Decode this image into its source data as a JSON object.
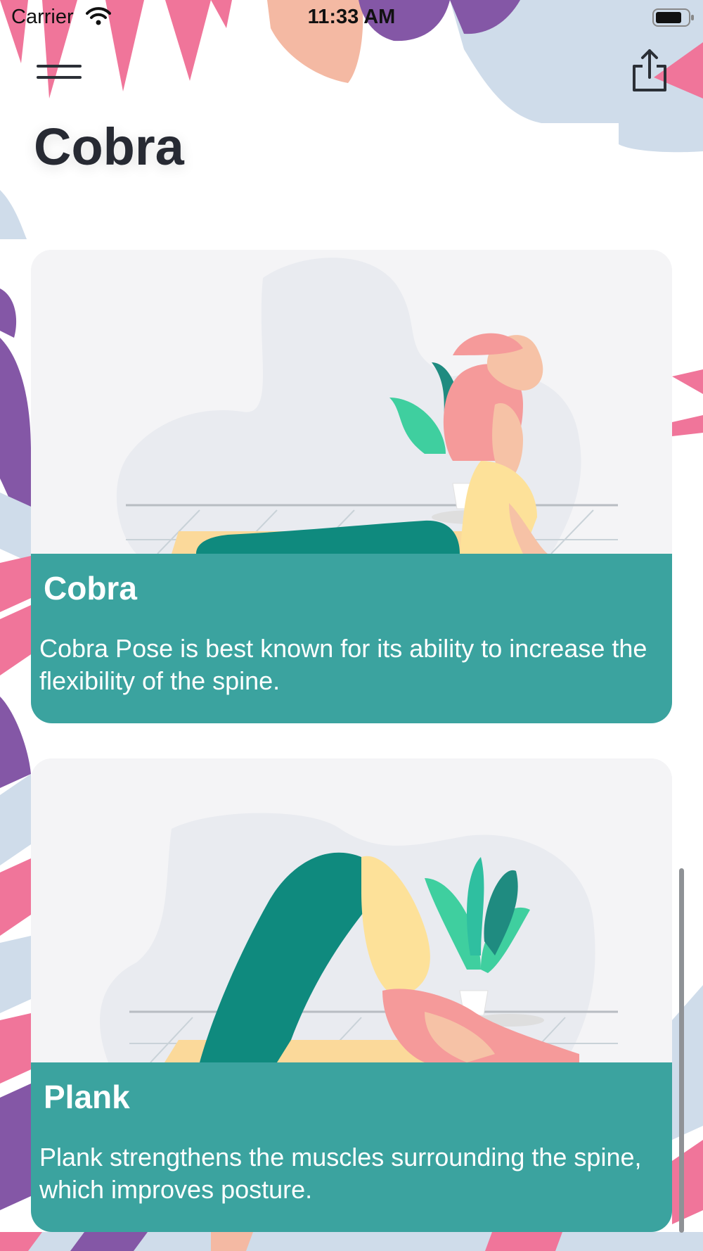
{
  "status_bar": {
    "carrier": "Carrier",
    "time": "11:33 AM"
  },
  "header": {
    "title": "Cobra",
    "menu_icon": "hamburger-icon",
    "share_icon": "share-icon"
  },
  "cards": [
    {
      "title": "Cobra",
      "description": "Cobra Pose is best known for its ability to increase the flexibility of the spine.",
      "illustration": "cobra-pose-illustration"
    },
    {
      "title": "Plank",
      "description": "Plank strengthens the muscles surrounding the spine, which improves posture.",
      "illustration": "plank-pose-illustration"
    }
  ],
  "colors": {
    "card_info": "#3ba39f",
    "leaf_pink": "#f0759a",
    "leaf_purple": "#8457a6",
    "leaf_blue": "#cfdcea",
    "title_text": "#272a33"
  }
}
